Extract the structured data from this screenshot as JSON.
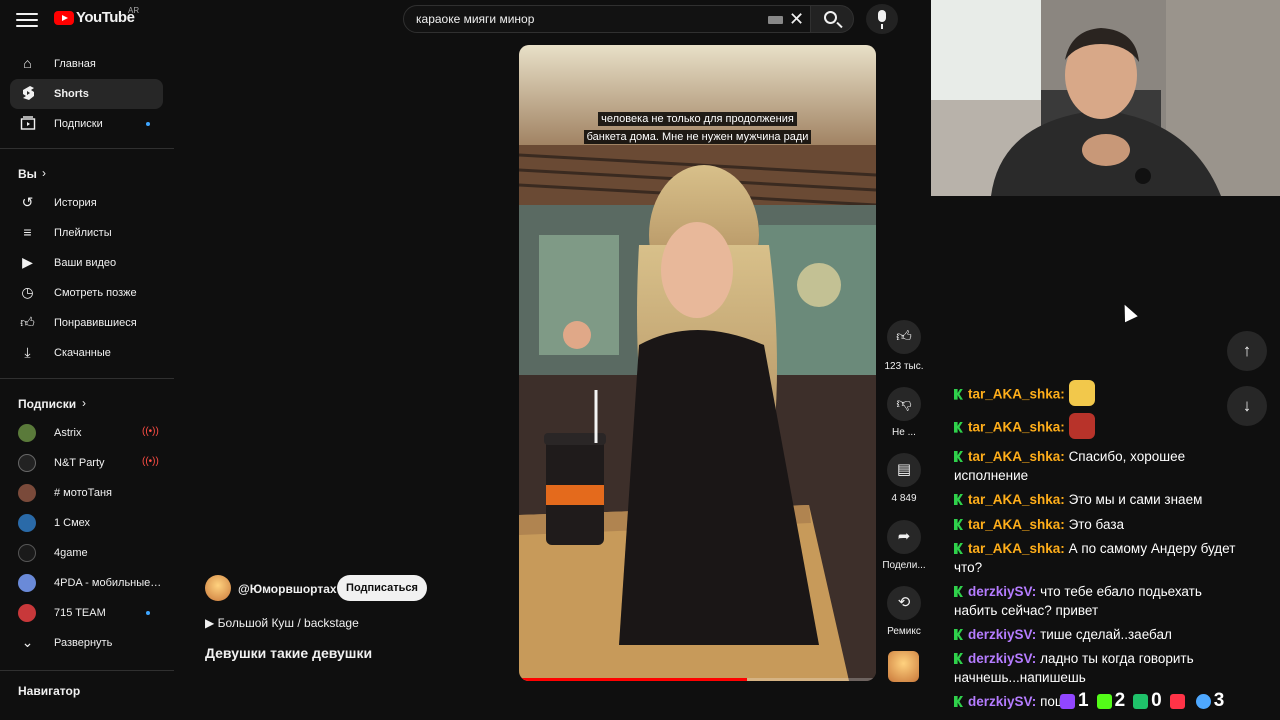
{
  "header": {
    "logo_text": "YouTube",
    "region": "AR",
    "search_value": "караоке мияги минор",
    "icons": [
      "menu-icon",
      "keyboard-icon",
      "clear-icon",
      "search-icon",
      "mic-icon"
    ]
  },
  "sidebar": {
    "main": [
      {
        "label": "Главная",
        "icon": "home-icon"
      },
      {
        "label": "Shorts",
        "icon": "shorts-icon",
        "active": true
      },
      {
        "label": "Подписки",
        "icon": "subscriptions-icon",
        "new": true
      }
    ],
    "you_title": "Вы",
    "you_items": [
      {
        "label": "История",
        "icon": "history-icon"
      },
      {
        "label": "Плейлисты",
        "icon": "playlists-icon"
      },
      {
        "label": "Ваши видео",
        "icon": "your-videos-icon"
      },
      {
        "label": "Смотреть позже",
        "icon": "watch-later-icon"
      },
      {
        "label": "Понравившиеся",
        "icon": "liked-icon"
      },
      {
        "label": "Скачанные",
        "icon": "downloads-icon"
      }
    ],
    "subs_title": "Подписки",
    "subscriptions": [
      {
        "label": "Astrix",
        "status": "live",
        "color": "#5a7a3a"
      },
      {
        "label": "N&T Party",
        "status": "live",
        "color": "#222222"
      },
      {
        "label": "# мотоТаня",
        "status": "",
        "color": "#7a4a3a"
      },
      {
        "label": "1 Смех",
        "status": "",
        "color": "#2a6aa8"
      },
      {
        "label": "4game",
        "status": "",
        "color": "#1a1a1a"
      },
      {
        "label": "4PDA - мобильные…",
        "status": "",
        "color": "#6a8ad8"
      },
      {
        "label": "715 TEAM",
        "status": "new",
        "color": "#c8383a"
      }
    ],
    "expand_label": "Развернуть",
    "navigator_title": "Навигатор"
  },
  "short": {
    "subtitle_line1": "человека не только для продолжения",
    "subtitle_line2": "банкета дома. Мне не нужен мужчина ради",
    "progress": 0.64,
    "channel": "@Юморвшортах",
    "subscribe_label": "Подписаться",
    "sound": "Большой Куш / backstage",
    "title": "Девушки такие девушки",
    "actions": {
      "like_count": "123 тыс.",
      "dislike_label": "Не ...",
      "comments_count": "4 849",
      "share_label": "Подели...",
      "remix_label": "Ремикс"
    }
  },
  "chat": {
    "messages": [
      {
        "user": "tar_AKA_shka:",
        "text": "",
        "emote": true,
        "emote_color": "#f2c84b",
        "color": "#ffae1a"
      },
      {
        "user": "tar_AKA_shka:",
        "text": "",
        "emote": true,
        "emote_color": "#b8332a",
        "color": "#ffae1a"
      },
      {
        "user": "tar_AKA_shka:",
        "text": "Спасибо, хорошее",
        "text2": "исполнение",
        "color": "#ffae1a"
      },
      {
        "user": "tar_AKA_shka:",
        "text": "Это мы и сами знаем",
        "color": "#ffae1a"
      },
      {
        "user": "tar_AKA_shka:",
        "text": "Это база",
        "color": "#ffae1a"
      },
      {
        "user": "tar_AKA_shka:",
        "text": "А по самому Андеру будет",
        "text2": "что?",
        "color": "#ffae1a"
      },
      {
        "user": "derzkiySV:",
        "text": "что тебе ебало подьехать",
        "text2": "набить сейчас? привет",
        "color": "#b57cff"
      },
      {
        "user": "derzkiySV:",
        "text": "тише сделай..заебал",
        "color": "#b57cff"
      },
      {
        "user": "derzkiySV:",
        "text": "ладно ты когда говорить",
        "text2": "начнешь...напишешь",
        "color": "#b57cff"
      },
      {
        "user": "derzkiySV:",
        "text": "пошел д",
        "color": "#b57cff"
      }
    ],
    "stats": [
      {
        "icon": "twitch-icon",
        "value": "1",
        "color": "#9146ff"
      },
      {
        "icon": "kick-icon",
        "value": "2",
        "color": "#53fc18"
      },
      {
        "icon": "trovo-icon",
        "value": "0",
        "color": "#1fc26a"
      },
      {
        "icon": "vk-live-icon",
        "value": "",
        "color": "#ff3347"
      },
      {
        "icon": "viewers-icon",
        "value": "3",
        "color": "#4ea8ff"
      }
    ]
  }
}
